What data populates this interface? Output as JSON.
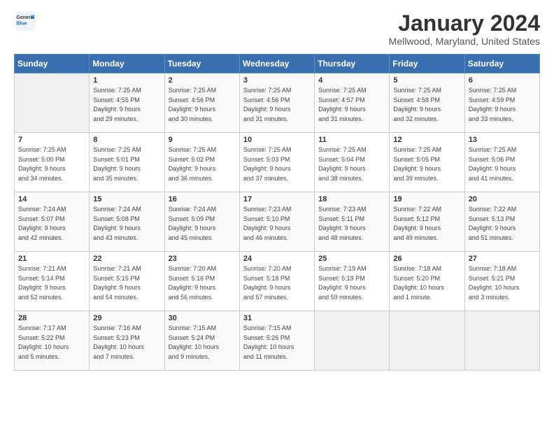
{
  "header": {
    "logo_general": "General",
    "logo_blue": "Blue",
    "month_title": "January 2024",
    "location": "Mellwood, Maryland, United States"
  },
  "days_of_week": [
    "Sunday",
    "Monday",
    "Tuesday",
    "Wednesday",
    "Thursday",
    "Friday",
    "Saturday"
  ],
  "weeks": [
    [
      {
        "day": "",
        "sunrise": "",
        "sunset": "",
        "daylight": ""
      },
      {
        "day": "1",
        "sunrise": "Sunrise: 7:25 AM",
        "sunset": "Sunset: 4:55 PM",
        "daylight": "Daylight: 9 hours and 29 minutes."
      },
      {
        "day": "2",
        "sunrise": "Sunrise: 7:25 AM",
        "sunset": "Sunset: 4:56 PM",
        "daylight": "Daylight: 9 hours and 30 minutes."
      },
      {
        "day": "3",
        "sunrise": "Sunrise: 7:25 AM",
        "sunset": "Sunset: 4:56 PM",
        "daylight": "Daylight: 9 hours and 31 minutes."
      },
      {
        "day": "4",
        "sunrise": "Sunrise: 7:25 AM",
        "sunset": "Sunset: 4:57 PM",
        "daylight": "Daylight: 9 hours and 31 minutes."
      },
      {
        "day": "5",
        "sunrise": "Sunrise: 7:25 AM",
        "sunset": "Sunset: 4:58 PM",
        "daylight": "Daylight: 9 hours and 32 minutes."
      },
      {
        "day": "6",
        "sunrise": "Sunrise: 7:25 AM",
        "sunset": "Sunset: 4:59 PM",
        "daylight": "Daylight: 9 hours and 33 minutes."
      }
    ],
    [
      {
        "day": "7",
        "sunrise": "Sunrise: 7:25 AM",
        "sunset": "Sunset: 5:00 PM",
        "daylight": "Daylight: 9 hours and 34 minutes."
      },
      {
        "day": "8",
        "sunrise": "Sunrise: 7:25 AM",
        "sunset": "Sunset: 5:01 PM",
        "daylight": "Daylight: 9 hours and 35 minutes."
      },
      {
        "day": "9",
        "sunrise": "Sunrise: 7:25 AM",
        "sunset": "Sunset: 5:02 PM",
        "daylight": "Daylight: 9 hours and 36 minutes."
      },
      {
        "day": "10",
        "sunrise": "Sunrise: 7:25 AM",
        "sunset": "Sunset: 5:03 PM",
        "daylight": "Daylight: 9 hours and 37 minutes."
      },
      {
        "day": "11",
        "sunrise": "Sunrise: 7:25 AM",
        "sunset": "Sunset: 5:04 PM",
        "daylight": "Daylight: 9 hours and 38 minutes."
      },
      {
        "day": "12",
        "sunrise": "Sunrise: 7:25 AM",
        "sunset": "Sunset: 5:05 PM",
        "daylight": "Daylight: 9 hours and 39 minutes."
      },
      {
        "day": "13",
        "sunrise": "Sunrise: 7:25 AM",
        "sunset": "Sunset: 5:06 PM",
        "daylight": "Daylight: 9 hours and 41 minutes."
      }
    ],
    [
      {
        "day": "14",
        "sunrise": "Sunrise: 7:24 AM",
        "sunset": "Sunset: 5:07 PM",
        "daylight": "Daylight: 9 hours and 42 minutes."
      },
      {
        "day": "15",
        "sunrise": "Sunrise: 7:24 AM",
        "sunset": "Sunset: 5:08 PM",
        "daylight": "Daylight: 9 hours and 43 minutes."
      },
      {
        "day": "16",
        "sunrise": "Sunrise: 7:24 AM",
        "sunset": "Sunset: 5:09 PM",
        "daylight": "Daylight: 9 hours and 45 minutes."
      },
      {
        "day": "17",
        "sunrise": "Sunrise: 7:23 AM",
        "sunset": "Sunset: 5:10 PM",
        "daylight": "Daylight: 9 hours and 46 minutes."
      },
      {
        "day": "18",
        "sunrise": "Sunrise: 7:23 AM",
        "sunset": "Sunset: 5:11 PM",
        "daylight": "Daylight: 9 hours and 48 minutes."
      },
      {
        "day": "19",
        "sunrise": "Sunrise: 7:22 AM",
        "sunset": "Sunset: 5:12 PM",
        "daylight": "Daylight: 9 hours and 49 minutes."
      },
      {
        "day": "20",
        "sunrise": "Sunrise: 7:22 AM",
        "sunset": "Sunset: 5:13 PM",
        "daylight": "Daylight: 9 hours and 51 minutes."
      }
    ],
    [
      {
        "day": "21",
        "sunrise": "Sunrise: 7:21 AM",
        "sunset": "Sunset: 5:14 PM",
        "daylight": "Daylight: 9 hours and 52 minutes."
      },
      {
        "day": "22",
        "sunrise": "Sunrise: 7:21 AM",
        "sunset": "Sunset: 5:15 PM",
        "daylight": "Daylight: 9 hours and 54 minutes."
      },
      {
        "day": "23",
        "sunrise": "Sunrise: 7:20 AM",
        "sunset": "Sunset: 5:16 PM",
        "daylight": "Daylight: 9 hours and 56 minutes."
      },
      {
        "day": "24",
        "sunrise": "Sunrise: 7:20 AM",
        "sunset": "Sunset: 5:18 PM",
        "daylight": "Daylight: 9 hours and 57 minutes."
      },
      {
        "day": "25",
        "sunrise": "Sunrise: 7:19 AM",
        "sunset": "Sunset: 5:19 PM",
        "daylight": "Daylight: 9 hours and 59 minutes."
      },
      {
        "day": "26",
        "sunrise": "Sunrise: 7:18 AM",
        "sunset": "Sunset: 5:20 PM",
        "daylight": "Daylight: 10 hours and 1 minute."
      },
      {
        "day": "27",
        "sunrise": "Sunrise: 7:18 AM",
        "sunset": "Sunset: 5:21 PM",
        "daylight": "Daylight: 10 hours and 3 minutes."
      }
    ],
    [
      {
        "day": "28",
        "sunrise": "Sunrise: 7:17 AM",
        "sunset": "Sunset: 5:22 PM",
        "daylight": "Daylight: 10 hours and 5 minutes."
      },
      {
        "day": "29",
        "sunrise": "Sunrise: 7:16 AM",
        "sunset": "Sunset: 5:23 PM",
        "daylight": "Daylight: 10 hours and 7 minutes."
      },
      {
        "day": "30",
        "sunrise": "Sunrise: 7:15 AM",
        "sunset": "Sunset: 5:24 PM",
        "daylight": "Daylight: 10 hours and 9 minutes."
      },
      {
        "day": "31",
        "sunrise": "Sunrise: 7:15 AM",
        "sunset": "Sunset: 5:26 PM",
        "daylight": "Daylight: 10 hours and 11 minutes."
      },
      {
        "day": "",
        "sunrise": "",
        "sunset": "",
        "daylight": ""
      },
      {
        "day": "",
        "sunrise": "",
        "sunset": "",
        "daylight": ""
      },
      {
        "day": "",
        "sunrise": "",
        "sunset": "",
        "daylight": ""
      }
    ]
  ]
}
